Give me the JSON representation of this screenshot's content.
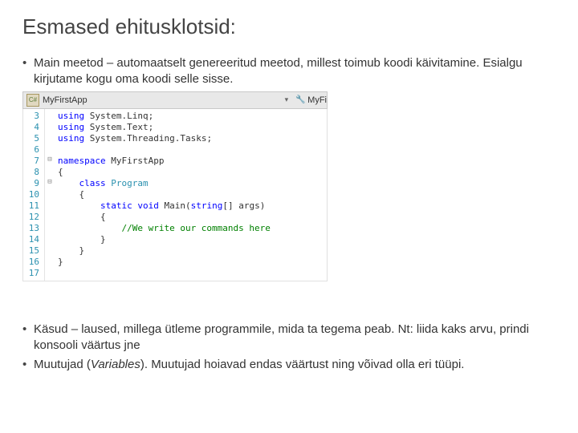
{
  "title": "Esmased ehitusklotsid:",
  "bullets": {
    "main": "Main meetod – automaatselt genereeritud meetod, millest toimub koodi käivitamine. Esialgu kirjutame kogu oma koodi selle sisse.",
    "commands": "Käsud – laused, millega ütleme programmile, mida ta tegema peab. Nt: liida kaks arvu, prindi konsooli väärtus jne",
    "vars_pre": "Muutujad (",
    "vars_em": "Variables",
    "vars_post": "). Muutujad hoiavad endas väärtust ning võivad olla eri tüüpi."
  },
  "editor": {
    "tab_label": "MyFirstApp",
    "dropdown_right": "MyFi",
    "line_numbers": [
      "3",
      "4",
      "5",
      "6",
      "7",
      "8",
      "9",
      "10",
      "11",
      "12",
      "13",
      "14",
      "15",
      "16",
      "17"
    ],
    "code": {
      "l3_kw": "using",
      "l3_rest": " System.Linq;",
      "l4_kw": "using",
      "l4_rest": " System.Text;",
      "l5_kw": "using",
      "l5_rest": " System.Threading.Tasks;",
      "l7_kw": "namespace",
      "l7_rest": " MyFirstApp",
      "l8": "{",
      "l9_kw": "    class",
      "l9_cls": " Program",
      "l10": "    {",
      "l11_kw1": "        static",
      "l11_kw2": " void",
      "l11_m": " Main(",
      "l11_kw3": "string",
      "l11_rest": "[] args)",
      "l12": "        {",
      "l13_cmt": "            //We write our commands here",
      "l14": "        }",
      "l15": "    }",
      "l16": "}"
    }
  }
}
